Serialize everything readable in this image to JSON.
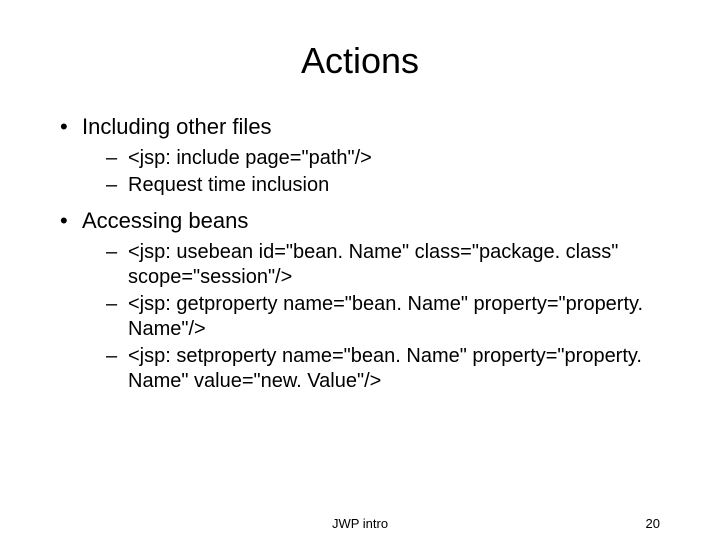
{
  "title": "Actions",
  "sections": [
    {
      "heading": "Including other files",
      "items": [
        "<jsp: include page=\"path\"/>",
        "Request time inclusion"
      ]
    },
    {
      "heading": "Accessing beans",
      "items": [
        "<jsp: usebean id=\"bean. Name\" class=\"package. class\" scope=\"session\"/>",
        "<jsp: getproperty name=\"bean. Name\" property=\"property. Name\"/>",
        "<jsp: setproperty name=\"bean. Name\" property=\"property. Name\" value=\"new. Value\"/>"
      ]
    }
  ],
  "footer": {
    "center": "JWP intro",
    "page": "20"
  }
}
